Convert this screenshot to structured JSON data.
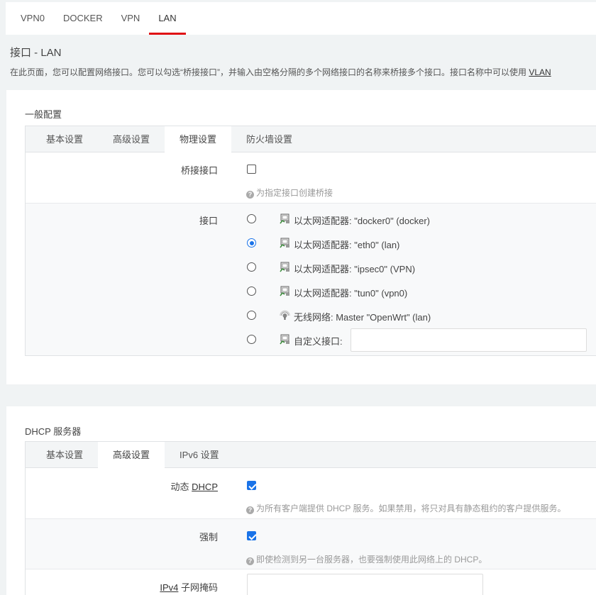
{
  "top_tabs": [
    "VPN0",
    "DOCKER",
    "VPN",
    "LAN"
  ],
  "page": {
    "title": "接口 - LAN",
    "description_pre": "在此页面，您可以配置网络接口。您可以勾选“桥接接口”，并输入由空格分隔的多个网络接口的名称来桥接多个接口。接口名称中可以使用 ",
    "description_link": "VLAN"
  },
  "general": {
    "title": "一般配置",
    "tabs": [
      "基本设置",
      "高级设置",
      "物理设置",
      "防火墙设置"
    ],
    "bridge_label": "桥接接口",
    "bridge_checked": false,
    "bridge_hint": "为指定接口创建桥接",
    "interface_label": "接口",
    "interfaces": [
      {
        "icon": "ethernet-adapter-icon",
        "text": "以太网适配器: \"docker0\" (docker)",
        "selected": false
      },
      {
        "icon": "ethernet-adapter-icon",
        "text": "以太网适配器: \"eth0\" (lan)",
        "selected": true
      },
      {
        "icon": "ethernet-adapter-icon",
        "text": "以太网适配器: \"ipsec0\" (VPN)",
        "selected": false
      },
      {
        "icon": "ethernet-adapter-icon",
        "text": "以太网适配器: \"tun0\" (vpn0)",
        "selected": false
      },
      {
        "icon": "wireless-icon",
        "text": "无线网络: Master \"OpenWrt\" (lan)",
        "selected": false
      },
      {
        "icon": "ethernet-adapter-icon",
        "text": "自定义接口:",
        "selected": false
      }
    ],
    "custom_value": ""
  },
  "dhcp": {
    "title": "DHCP 服务器",
    "tabs": [
      "基本设置",
      "高级设置",
      "IPv6 设置"
    ],
    "dynamic_label_pre": "动态 ",
    "dynamic_label_link": "DHCP",
    "dynamic_checked": true,
    "dynamic_hint": "为所有客户端提供 DHCP 服务。如果禁用，将只对具有静态租约的客户提供服务。",
    "force_label": "强制",
    "force_checked": true,
    "force_hint": "即使检测到另一台服务器，也要强制使用此网络上的 DHCP。",
    "netmask_label_link": "IPv4",
    "netmask_label_post": " 子网掩码",
    "netmask_value": ""
  },
  "colors": {
    "accent": "#e00f14",
    "check": "#1a73e8"
  }
}
